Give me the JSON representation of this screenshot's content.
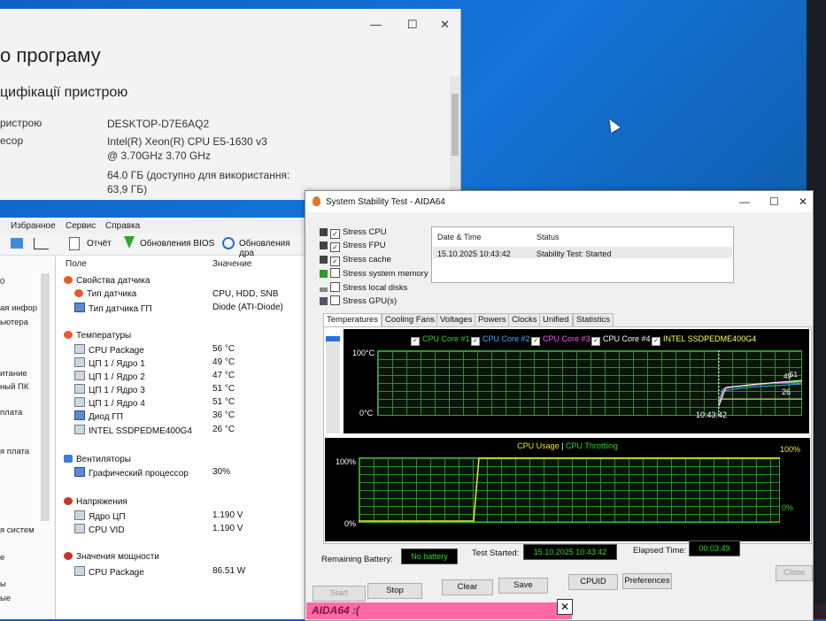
{
  "about": {
    "title": "о програму",
    "section": "цифікації пристрою",
    "rows": [
      {
        "label": "ристрою",
        "value": "DESKTOP-D7E6AQ2"
      },
      {
        "label": "есор",
        "value": "Intel(R) Xeon(R) CPU E5-1630 v3 @ 3.70GHz   3.70 GHz"
      },
      {
        "label": "",
        "value": "64.0 ГБ (доступно для використання: 63,9 ГБ)"
      }
    ],
    "minimize": "—",
    "maximize": "☐",
    "close": "✕"
  },
  "sensor": {
    "menu": [
      "Избранное",
      "Сервис",
      "Справка"
    ],
    "toolbar": {
      "report": "Отчёт",
      "bios": "Обновления BIOS",
      "drivers": "Обновления дра"
    },
    "left_items": [
      "0",
      "ая инфор",
      "ьютера",
      "итание",
      "ный ПК",
      "плата",
      "я плата",
      "я систем",
      "е",
      "ы",
      "ые"
    ],
    "columns": {
      "field": "Поле",
      "value": "Значение"
    },
    "rows": [
      {
        "name": "Свойства датчика",
        "value": "",
        "indent": 0,
        "icon": "sensor-props-icon"
      },
      {
        "name": "Тип датчика",
        "value": "CPU, HDD, SNB",
        "indent": 1,
        "icon": "sensor-type-icon"
      },
      {
        "name": "Тип датчика ГП",
        "value": "Diode  (ATI-Diode)",
        "indent": 1,
        "icon": "gpu-sensor-icon"
      },
      {
        "name": "Температуры",
        "value": "",
        "indent": 0,
        "icon": "temperature-icon"
      },
      {
        "name": "CPU Package",
        "value": "56 °C",
        "indent": 1,
        "icon": "cpu-icon"
      },
      {
        "name": "ЦП 1 / Ядро 1",
        "value": "49 °C",
        "indent": 1,
        "icon": "cpu-icon"
      },
      {
        "name": "ЦП 1 / Ядро 2",
        "value": "47 °C",
        "indent": 1,
        "icon": "cpu-icon"
      },
      {
        "name": "ЦП 1 / Ядро 3",
        "value": "51 °C",
        "indent": 1,
        "icon": "cpu-icon"
      },
      {
        "name": "ЦП 1 / Ядро 4",
        "value": "51 °C",
        "indent": 1,
        "icon": "cpu-icon"
      },
      {
        "name": "Диод ГП",
        "value": "36 °C",
        "indent": 1,
        "icon": "gpu-icon"
      },
      {
        "name": "INTEL SSDPEDME400G4",
        "value": "26 °C",
        "indent": 1,
        "icon": "disk-icon"
      },
      {
        "name": "Вентиляторы",
        "value": "",
        "indent": 0,
        "icon": "fan-icon"
      },
      {
        "name": "Графический процессор",
        "value": "30%",
        "indent": 1,
        "icon": "gpu-icon"
      },
      {
        "name": "Напряжения",
        "value": "",
        "indent": 0,
        "icon": "voltage-icon"
      },
      {
        "name": "Ядро ЦП",
        "value": "1.190 V",
        "indent": 1,
        "icon": "cpu-icon"
      },
      {
        "name": "CPU VID",
        "value": "1.190 V",
        "indent": 1,
        "icon": "cpu-icon"
      },
      {
        "name": "Значения мощности",
        "value": "",
        "indent": 0,
        "icon": "power-icon"
      },
      {
        "name": "CPU Package",
        "value": "86.51 W",
        "indent": 1,
        "icon": "cpu-icon"
      }
    ]
  },
  "aida": {
    "title": "System Stability Test - AIDA64",
    "stress": [
      {
        "label": "Stress CPU",
        "checked": true
      },
      {
        "label": "Stress FPU",
        "checked": true
      },
      {
        "label": "Stress cache",
        "checked": true
      },
      {
        "label": "Stress system memory",
        "checked": false
      },
      {
        "label": "Stress local disks",
        "checked": false
      },
      {
        "label": "Stress GPU(s)",
        "checked": false
      }
    ],
    "log": {
      "col_date": "Date & Time",
      "col_status": "Status",
      "date": "15.10.2025 10:43:42",
      "status": "Stability Test: Started"
    },
    "tabs": [
      "Temperatures",
      "Cooling Fans",
      "Voltages",
      "Powers",
      "Clocks",
      "Unified",
      "Statistics"
    ],
    "temp_graph": {
      "legend": [
        {
          "label": "CPU Core #1",
          "color": "#2bd62b"
        },
        {
          "label": "CPU Core #2",
          "color": "#3ab0ff"
        },
        {
          "label": "CPU Core #3",
          "color": "#ff55ff"
        },
        {
          "label": "CPU Core #4",
          "color": "#ffffff"
        },
        {
          "label": "INTEL SSDPEDME400G4",
          "color": "#ffff66"
        }
      ],
      "ymax": "100°C",
      "ymin": "0°C",
      "time": "10:43:42",
      "val_high": "49",
      "val_high2": "51",
      "val_low": "26"
    },
    "cpu_graph": {
      "title_usage": "CPU Usage",
      "sep": "|",
      "title_throttle": "CPU Throttling",
      "left_max": "100%",
      "left_min": "0%",
      "right_max": "100%",
      "right_min": "0%"
    },
    "info": {
      "battery_label": "Remaining Battery:",
      "battery_value": "No battery",
      "started_label": "Test Started:",
      "started_value": "15.10.2025 10:43:42",
      "elapsed_label": "Elapsed Time:",
      "elapsed_value": "00:03:49"
    },
    "buttons": {
      "start": "Start",
      "stop": "Stop",
      "clear": "Clear",
      "save": "Save",
      "cpuid": "CPUID",
      "preferences": "Preferences",
      "close": "Close"
    },
    "wc": {
      "min": "—",
      "max": "☐",
      "close": "✕"
    }
  },
  "banner": {
    "text": "AIDA64 :(",
    "close": "✕"
  }
}
